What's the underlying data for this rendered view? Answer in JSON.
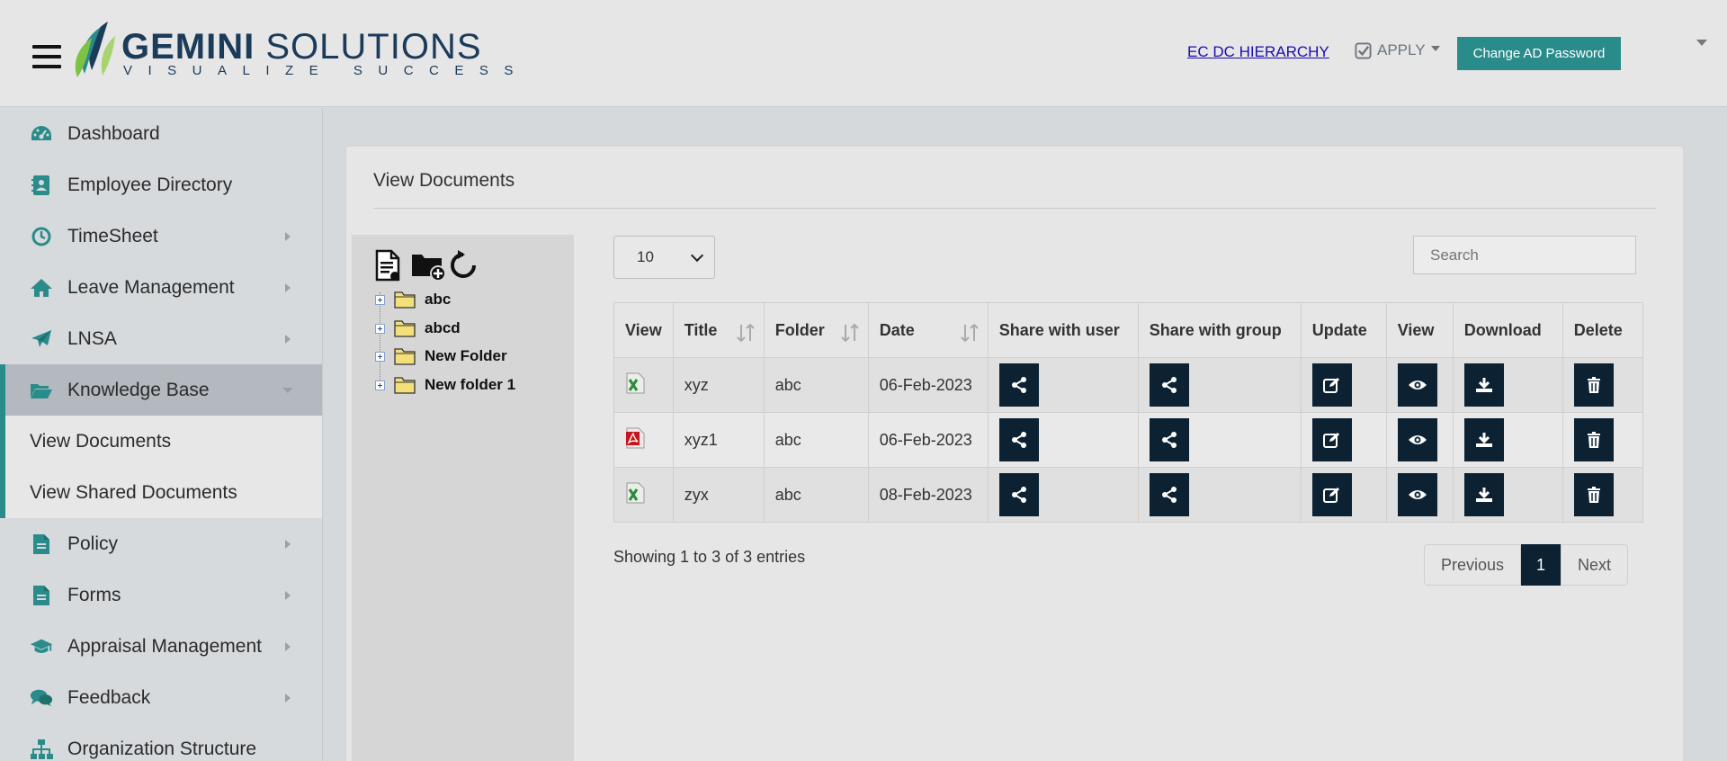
{
  "header": {
    "logo_main_1": "GEMINI",
    "logo_main_2": "SOLUTIONS",
    "logo_tagline": "VISUALIZE SUCCESS",
    "hierarchy_link": "EC DC HIERARCHY",
    "apply_label": "APPLY",
    "change_password_label": "Change AD Password"
  },
  "sidebar": {
    "items": [
      {
        "label": "Dashboard",
        "icon": "dashboard-icon"
      },
      {
        "label": "Employee Directory",
        "icon": "directory-icon"
      },
      {
        "label": "TimeSheet",
        "icon": "clock-icon"
      },
      {
        "label": "Leave Management",
        "icon": "home-icon"
      },
      {
        "label": "LNSA",
        "icon": "paper-plane-icon"
      },
      {
        "label": "Knowledge Base",
        "icon": "folder-open-icon"
      },
      {
        "label": "Policy",
        "icon": "document-icon"
      },
      {
        "label": "Forms",
        "icon": "document-icon"
      },
      {
        "label": "Appraisal Management",
        "icon": "graduation-cap-icon"
      },
      {
        "label": "Feedback",
        "icon": "comments-icon"
      },
      {
        "label": "Organization Structure",
        "icon": "sitemap-icon"
      }
    ],
    "sub_items": [
      "View Documents",
      "View Shared Documents"
    ]
  },
  "main": {
    "title": "View Documents",
    "page_length": "10",
    "search_placeholder": "Search",
    "tree": {
      "folders": [
        "abc",
        "abcd",
        "New Folder",
        "New folder 1"
      ]
    },
    "table": {
      "columns": [
        "View",
        "Title",
        "Folder",
        "Date",
        "Share with user",
        "Share with group",
        "Update",
        "View",
        "Download",
        "Delete"
      ],
      "rows": [
        {
          "file_type": "excel",
          "title": "xyz",
          "folder": "abc",
          "date": "06-Feb-2023"
        },
        {
          "file_type": "pdf",
          "title": "xyz1",
          "folder": "abc",
          "date": "06-Feb-2023"
        },
        {
          "file_type": "excel",
          "title": "zyx",
          "folder": "abc",
          "date": "08-Feb-2023"
        }
      ]
    },
    "info": "Showing 1 to 3 of 3 entries",
    "pagination": {
      "previous": "Previous",
      "current": "1",
      "next": "Next"
    }
  },
  "colors": {
    "accent": "#2a8c8a",
    "dark_button": "#0c2233",
    "link": "#1a0dab"
  }
}
